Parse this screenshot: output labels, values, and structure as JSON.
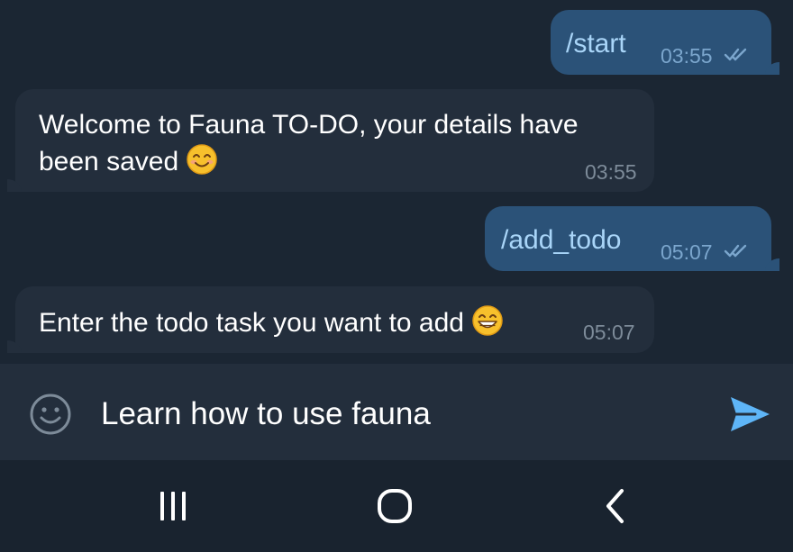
{
  "colors": {
    "chat_background": "#1b2633",
    "outgoing_bubble": "#2b5278",
    "incoming_bubble": "#232e3c",
    "outgoing_text": "#a9d5f8",
    "incoming_text": "#ffffff",
    "outgoing_time": "#7ba6cd",
    "incoming_time": "#7d8b99",
    "accent": "#5eb5f7",
    "input_bar": "#232e3c",
    "nav_bar": "#19232f"
  },
  "messages": [
    {
      "direction": "outgoing",
      "text": "/start",
      "time": "03:55",
      "status_icon": "double-check-icon"
    },
    {
      "direction": "incoming",
      "lines": [
        "Welcome to Fauna TO-DO, your details have",
        "been saved"
      ],
      "emoji": "smiling-face-icon",
      "time": "03:55"
    },
    {
      "direction": "outgoing",
      "text": "/add_todo",
      "time": "05:07",
      "status_icon": "double-check-icon"
    },
    {
      "direction": "incoming",
      "text": "Enter the todo task you want to add",
      "emoji": "grinning-face-icon",
      "time": "05:07"
    }
  ],
  "composer": {
    "emoji_button_icon": "smiley-icon",
    "text": "Learn how to use fauna",
    "send_icon": "send-icon"
  },
  "navigation": {
    "recents_icon": "recent-apps-icon",
    "home_icon": "home-icon",
    "back_icon": "back-icon"
  }
}
